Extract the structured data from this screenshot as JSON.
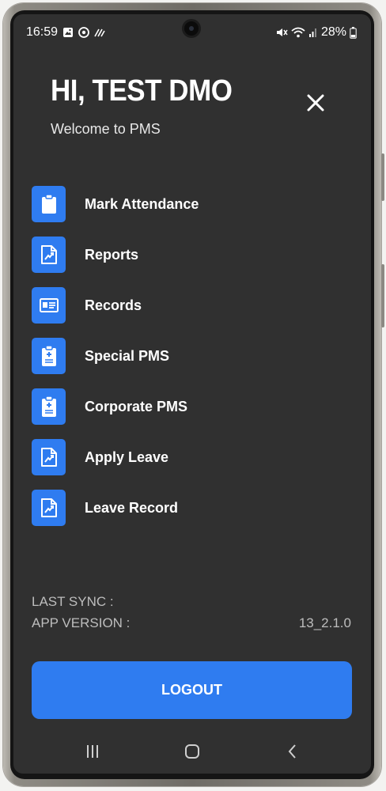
{
  "status_bar": {
    "time": "16:59",
    "battery": "28%",
    "left_icons": [
      "gallery-icon",
      "messenger-icon",
      "signal-wave-icon"
    ],
    "right_icons": [
      "mute-icon",
      "wifi-icon",
      "cell-signal-icon",
      "battery-icon"
    ]
  },
  "drawer": {
    "greeting": "HI, TEST DMO",
    "welcome": "Welcome to PMS",
    "accent_color": "#2f7cf0",
    "background_color": "#303030",
    "menu": [
      {
        "label": "Mark Attendance",
        "icon": "clipboard-icon"
      },
      {
        "label": "Reports",
        "icon": "report-chart-icon"
      },
      {
        "label": "Records",
        "icon": "id-card-icon"
      },
      {
        "label": "Special PMS",
        "icon": "medical-clipboard-icon"
      },
      {
        "label": "Corporate PMS",
        "icon": "medical-clipboard-icon"
      },
      {
        "label": "Apply Leave",
        "icon": "report-chart-icon"
      },
      {
        "label": "Leave Record",
        "icon": "report-chart-icon"
      }
    ],
    "last_sync_label": "LAST SYNC :",
    "last_sync_value": "",
    "app_version_label": "APP VERSION :",
    "app_version_value": "13_2.1.0",
    "logout_label": "LOGOUT"
  },
  "nav_bar": {
    "items": [
      "recent-apps-icon",
      "home-icon",
      "back-icon"
    ]
  }
}
